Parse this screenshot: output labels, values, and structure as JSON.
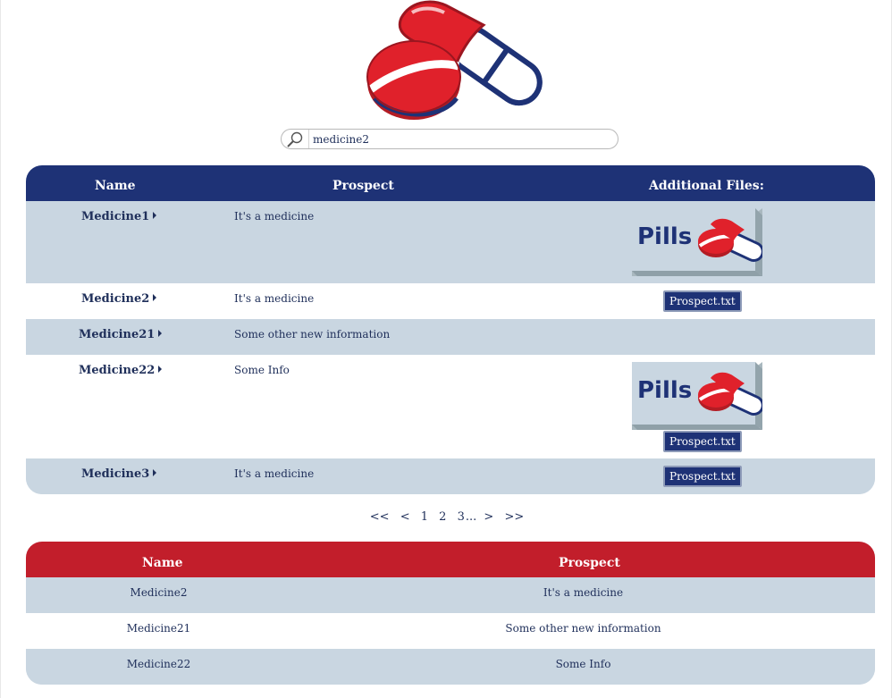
{
  "search": {
    "value": "medicine2"
  },
  "main_table": {
    "headers": {
      "name": "Name",
      "prospect": "Prospect",
      "files": "Additional Files:"
    },
    "rows": [
      {
        "name": "Medicine1",
        "prospect": "It's a medicine",
        "image": "Pills",
        "file": ""
      },
      {
        "name": "Medicine2",
        "prospect": "It's a medicine",
        "image": "",
        "file": "Prospect.txt"
      },
      {
        "name": "Medicine21",
        "prospect": "Some other new information",
        "image": "",
        "file": ""
      },
      {
        "name": "Medicine22",
        "prospect": "Some Info",
        "image": "Pills",
        "file": "Prospect.txt"
      },
      {
        "name": "Medicine3",
        "prospect": "It's a medicine",
        "image": "",
        "file": "Prospect.txt"
      }
    ]
  },
  "pager": {
    "first": "<<",
    "prev": "<",
    "pages": [
      "1",
      "2",
      "3"
    ],
    "ellipsis": "...",
    "next": ">",
    "last": ">>"
  },
  "results_table": {
    "headers": {
      "name": "Name",
      "prospect": "Prospect"
    },
    "rows": [
      {
        "name": "Medicine2",
        "prospect": "It's a medicine"
      },
      {
        "name": "Medicine21",
        "prospect": "Some other new information"
      },
      {
        "name": "Medicine22",
        "prospect": "Some Info"
      }
    ]
  },
  "colors": {
    "navy": "#1e3276",
    "red": "#c21e2b",
    "row_blue": "#c9d6e1"
  },
  "icons": {
    "search": "magnifier-icon",
    "logo": "pill-capsule-logo"
  }
}
